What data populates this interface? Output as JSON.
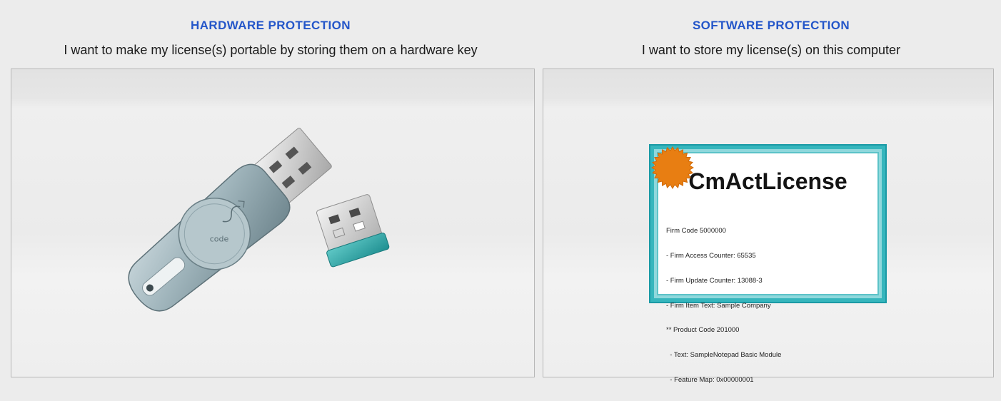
{
  "hardware": {
    "heading": "HARDWARE PROTECTION",
    "subtitle": "I want to make my license(s) portable by storing them on a hardware key"
  },
  "software": {
    "heading": "SOFTWARE PROTECTION",
    "subtitle": "I want to store my license(s) on this computer",
    "certificate": {
      "title": "CmActLicense",
      "lines": [
        "Firm Code 5000000",
        "- Firm Access Counter: 65535",
        "- Firm Update Counter: 13088-3",
        "- Firm Item Text: Sample Company",
        "** Product Code 201000",
        "  - Text: SampleNotepad Basic Module",
        "  - Feature Map: 0x00000001"
      ]
    }
  },
  "colors": {
    "heading": "#2456c9",
    "frame_teal": "#36b6bd",
    "seal_orange": "#e87e12"
  }
}
